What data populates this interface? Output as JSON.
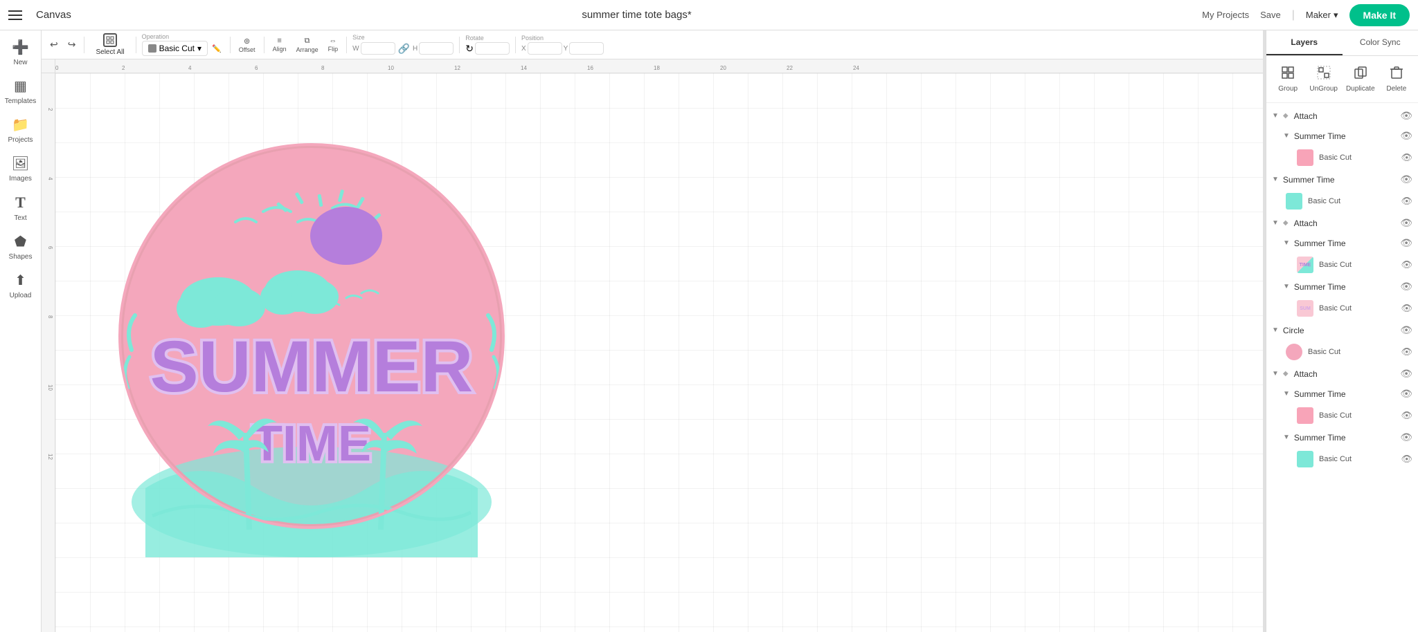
{
  "app": {
    "title": "Canvas",
    "project_title": "summer time tote bags*"
  },
  "topbar": {
    "my_projects": "My Projects",
    "save": "Save",
    "separator": "|",
    "maker": "Maker",
    "make_it": "Make It"
  },
  "toolbar": {
    "undo": "↩",
    "redo": "↪",
    "operation_label": "Operation",
    "operation_value": "Basic Cut",
    "edit": "Edit",
    "offset": "Offset",
    "align": "Align",
    "arrange": "Arrange",
    "flip": "Flip",
    "size": "Size",
    "size_w": "W",
    "size_h": "H",
    "rotate": "Rotate",
    "position": "Position",
    "pos_x": "X",
    "pos_y": "Y",
    "select_all": "Select All"
  },
  "sidebar": {
    "items": [
      {
        "id": "new",
        "label": "New",
        "icon": "➕"
      },
      {
        "id": "templates",
        "label": "Templates",
        "icon": "▦"
      },
      {
        "id": "projects",
        "label": "Projects",
        "icon": "📁"
      },
      {
        "id": "images",
        "label": "Images",
        "icon": "🖼"
      },
      {
        "id": "text",
        "label": "Text",
        "icon": "T"
      },
      {
        "id": "shapes",
        "label": "Shapes",
        "icon": "⬟"
      },
      {
        "id": "upload",
        "label": "Upload",
        "icon": "⬆"
      }
    ]
  },
  "right_panel": {
    "tabs": [
      {
        "id": "layers",
        "label": "Layers",
        "active": true
      },
      {
        "id": "color_sync",
        "label": "Color Sync",
        "active": false
      }
    ],
    "actions": [
      {
        "id": "group",
        "label": "Group",
        "icon": "▣"
      },
      {
        "id": "ungroup",
        "label": "UnGroup",
        "icon": "⊡"
      },
      {
        "id": "duplicate",
        "label": "Duplicate",
        "icon": "⧉"
      },
      {
        "id": "delete",
        "label": "Delete",
        "icon": "🗑"
      }
    ],
    "layers": [
      {
        "type": "group",
        "name": "Attach",
        "expanded": true,
        "visible": true,
        "children": [
          {
            "type": "group",
            "name": "Summer Time",
            "expanded": true,
            "visible": true,
            "children": [
              {
                "type": "item",
                "name": "Basic Cut",
                "thumb_color": "thumb-pink",
                "visible": true
              }
            ]
          }
        ]
      },
      {
        "type": "group",
        "name": "Summer Time",
        "expanded": true,
        "visible": true,
        "children": [
          {
            "type": "item",
            "name": "Basic Cut",
            "thumb_color": "thumb-teal",
            "visible": true
          }
        ]
      },
      {
        "type": "group",
        "name": "Attach",
        "expanded": true,
        "visible": true,
        "children": [
          {
            "type": "group",
            "name": "Summer Time",
            "expanded": true,
            "visible": true,
            "children": [
              {
                "type": "item",
                "name": "Basic Cut",
                "thumb_color": "thumb-time",
                "visible": true
              }
            ]
          },
          {
            "type": "group",
            "name": "Summer Time",
            "expanded": true,
            "visible": true,
            "children": [
              {
                "type": "item",
                "name": "Basic Cut",
                "thumb_color": "thumb-light-pink",
                "visible": true
              }
            ]
          }
        ]
      },
      {
        "type": "group",
        "name": "Circle",
        "expanded": true,
        "visible": true,
        "children": [
          {
            "type": "item",
            "name": "Basic Cut",
            "thumb_color": "thumb-pink",
            "visible": true
          }
        ]
      },
      {
        "type": "group",
        "name": "Attach",
        "expanded": true,
        "visible": true,
        "children": [
          {
            "type": "group",
            "name": "Summer Time",
            "expanded": true,
            "visible": true,
            "children": [
              {
                "type": "item",
                "name": "Basic Cut",
                "thumb_color": "thumb-pink",
                "visible": true
              }
            ]
          },
          {
            "type": "group",
            "name": "Summer Time",
            "expanded": true,
            "visible": true,
            "children": [
              {
                "type": "item",
                "name": "Basic Cut",
                "thumb_color": "thumb-teal",
                "visible": true
              }
            ]
          }
        ]
      }
    ]
  },
  "canvas": {
    "ruler_marks": [
      "0",
      "2",
      "4",
      "6",
      "8",
      "10",
      "12",
      "14",
      "16",
      "18",
      "20",
      "22",
      "24"
    ],
    "ruler_marks_v": [
      "2",
      "4",
      "6",
      "8",
      "10",
      "12"
    ]
  },
  "colors": {
    "accent": "#00c08b",
    "pink": "#f4a7bc",
    "teal": "#7de8d8",
    "purple": "#b57edc",
    "light_purple": "#d4a8e8"
  }
}
